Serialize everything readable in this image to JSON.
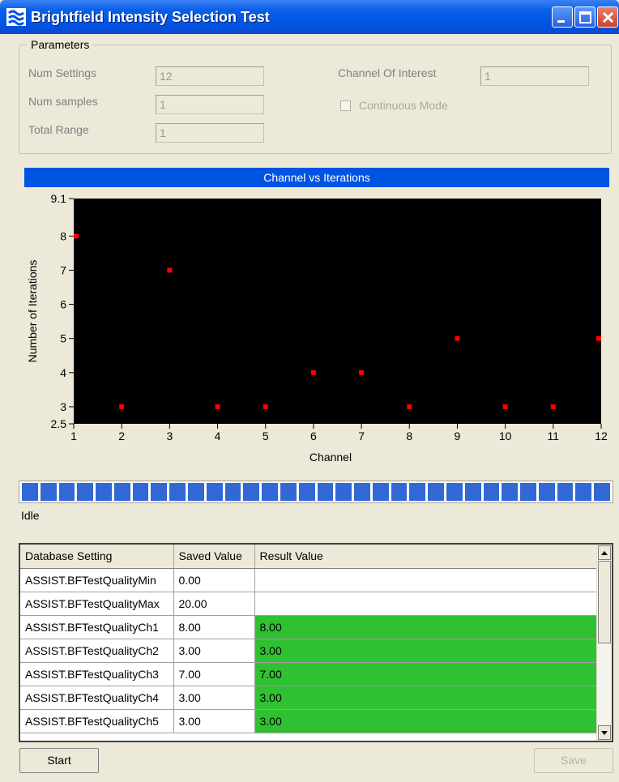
{
  "window": {
    "title": "Brightfield Intensity Selection Test"
  },
  "parameters": {
    "legend": "Parameters",
    "num_settings_label": "Num Settings",
    "num_settings_value": "12",
    "num_samples_label": "Num samples",
    "num_samples_value": "1",
    "total_range_label": "Total Range",
    "total_range_value": "1",
    "channel_of_interest_label": "Channel Of Interest",
    "channel_of_interest_value": "1",
    "continuous_mode_label": "Continuous Mode"
  },
  "chart_data": {
    "type": "scatter",
    "title": "Channel vs Iterations",
    "xlabel": "Channel",
    "ylabel": "Number of Iterations",
    "xlim": [
      1,
      12
    ],
    "ylim": [
      2.5,
      9.1
    ],
    "x_ticks": [
      1,
      2,
      3,
      4,
      5,
      6,
      7,
      8,
      9,
      10,
      11,
      12
    ],
    "y_ticks": [
      "2.5",
      "3",
      "4",
      "5",
      "6",
      "7",
      "8",
      "9.1"
    ],
    "x": [
      1,
      2,
      3,
      4,
      5,
      6,
      7,
      8,
      9,
      10,
      11,
      12
    ],
    "y": [
      8,
      3,
      7,
      3,
      3,
      4,
      4,
      3,
      5,
      3,
      3,
      5
    ],
    "background": "#000000",
    "marker_color": "#ff0000",
    "grid": false
  },
  "progress": {
    "segments": 32,
    "filled_fraction": 1.0,
    "color": "#3168d5"
  },
  "status": {
    "text": "Idle"
  },
  "table": {
    "headers": [
      "Database Setting",
      "Saved Value",
      "Result Value"
    ],
    "rows": [
      {
        "setting": "ASSIST.BFTestQualityMin",
        "saved": "0.00",
        "result": ""
      },
      {
        "setting": "ASSIST.BFTestQualityMax",
        "saved": "20.00",
        "result": ""
      },
      {
        "setting": "ASSIST.BFTestQualityCh1",
        "saved": "8.00",
        "result": "8.00"
      },
      {
        "setting": "ASSIST.BFTestQualityCh2",
        "saved": "3.00",
        "result": "3.00"
      },
      {
        "setting": "ASSIST.BFTestQualityCh3",
        "saved": "7.00",
        "result": "7.00"
      },
      {
        "setting": "ASSIST.BFTestQualityCh4",
        "saved": "3.00",
        "result": "3.00"
      },
      {
        "setting": "ASSIST.BFTestQualityCh5",
        "saved": "3.00",
        "result": "3.00"
      }
    ],
    "result_highlight_color": "#2fc132"
  },
  "buttons": {
    "start": "Start",
    "save": "Save"
  }
}
